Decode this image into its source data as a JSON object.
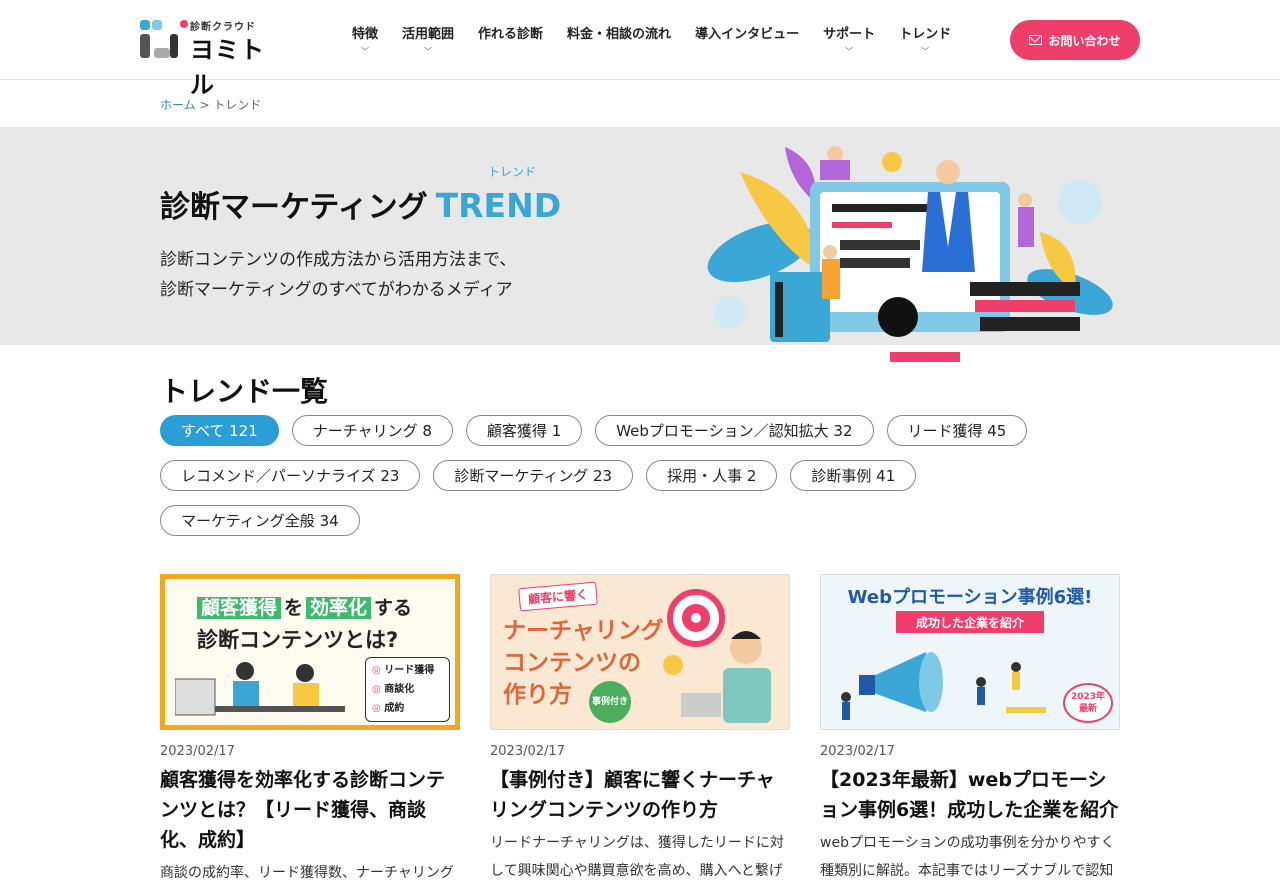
{
  "brand": {
    "small": "診断クラウド",
    "name": "ヨミトル"
  },
  "nav": [
    {
      "label": "特徴",
      "has_dropdown": true
    },
    {
      "label": "活用範囲",
      "has_dropdown": true
    },
    {
      "label": "作れる診断",
      "has_dropdown": false
    },
    {
      "label": "料金・相談の流れ",
      "has_dropdown": false
    },
    {
      "label": "導入インタビュー",
      "has_dropdown": false
    },
    {
      "label": "サポート",
      "has_dropdown": true
    },
    {
      "label": "トレンド",
      "has_dropdown": true
    }
  ],
  "contact_button": "お問い合わせ",
  "breadcrumb": {
    "home": "ホーム",
    "separator": ">",
    "current": "トレンド"
  },
  "hero": {
    "title": "診断マーケティング",
    "title_en": "TREND",
    "title_ruby": "トレンド",
    "desc_line1": "診断コンテンツの作成方法から活用方法まで、",
    "desc_line2": "診断マーケティングのすべてがわかるメディア"
  },
  "section_title": "トレンド一覧",
  "tags": [
    {
      "label": "すべて 121",
      "active": true
    },
    {
      "label": "ナーチャリング 8",
      "active": false
    },
    {
      "label": "顧客獲得 1",
      "active": false
    },
    {
      "label": "Webプロモーション／認知拡大 32",
      "active": false
    },
    {
      "label": "リード獲得 45",
      "active": false
    },
    {
      "label": "レコメンド／パーソナライズ 23",
      "active": false
    },
    {
      "label": "診断マーケティング 23",
      "active": false
    },
    {
      "label": "採用・人事 2",
      "active": false
    },
    {
      "label": "診断事例 41",
      "active": false
    },
    {
      "label": "マーケティング全般 34",
      "active": false
    }
  ],
  "cards": [
    {
      "date": "2023/02/17",
      "title": "顧客獲得を効率化する診断コンテンツとは？【リード獲得、商談化、成約】",
      "excerpt": "商談の成約率、リード獲得数、ナーチャリング",
      "thumb": {
        "w1": "顧客獲得",
        "w2": "を",
        "w3": "効率化",
        "w4": "する",
        "line2": "診断コンテンツとは?",
        "bullets": [
          "リード獲得",
          "商談化",
          "成約"
        ]
      }
    },
    {
      "date": "2023/02/17",
      "title": "【事例付き】顧客に響くナーチャリングコンテンツの作り方",
      "excerpt": "リードナーチャリングは、獲得したリードに対して興味関心や購買意欲を高め、購入へと繋げ",
      "thumb": {
        "tag": "顧客に響く",
        "line1": "ナーチャリング",
        "line2": "コンテンツの",
        "line3": "作り方",
        "badge": "事例付き"
      }
    },
    {
      "date": "2023/02/17",
      "title": "【2023年最新】webプロモーション事例6選！成功した企業を紹介",
      "excerpt": "webプロモーションの成功事例を分かりやすく種類別に解説。本記事ではリーズナブルで認知",
      "thumb": {
        "headline": "Webプロモーション事例6選!",
        "sub": "成功した企業を紹介",
        "badge_line1": "2023年",
        "badge_line2": "最新"
      }
    }
  ],
  "colors": {
    "accent_pink": "#ef3e6a",
    "accent_blue": "#2a9fd6",
    "hero_bg": "#e8e8e8"
  }
}
